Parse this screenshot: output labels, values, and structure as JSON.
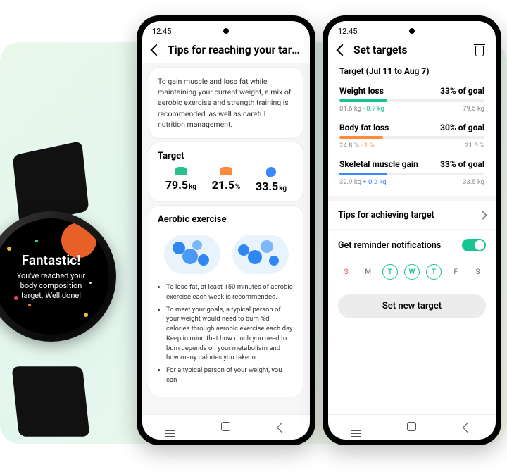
{
  "watch": {
    "title": "Fantastic!",
    "message": "You've reached your body composition target. Well done!"
  },
  "phone1": {
    "status_time": "12:45",
    "appbar_title": "Tips for reaching your targets",
    "intro": "To gain muscle and lose fat while maintaining your current weight, a mix of aerobic exercise and strength training is recommended, as well as careful nutrition management.",
    "target_heading": "Target",
    "metrics": {
      "weight": {
        "value": "79.5",
        "unit": "kg"
      },
      "bodyfat": {
        "value": "21.5",
        "unit": "%"
      },
      "muscle": {
        "value": "33.5",
        "unit": "kg"
      }
    },
    "aerobic_heading": "Aerobic exercise",
    "bullets": [
      "To lose fat, at least 150 minutes of aerobic exercise each week is recommended.",
      "To meet your goals, a typical person of your weight would need to burn %d calories through aerobic exercise each day. Keep in mind that how much you need to burn depends on your metabolism and how many calories you take in.",
      "For a typical person of your weight, you can"
    ]
  },
  "phone2": {
    "status_time": "12:45",
    "appbar_title": "Set targets",
    "period_label": "Target (Jul 11 to Aug 7)",
    "goals": [
      {
        "label": "Weight loss",
        "pct": "33% of goal",
        "fill": 33,
        "color": "green",
        "from": "81.6 kg",
        "delta": "- 0.7 kg",
        "to": "79.5 kg"
      },
      {
        "label": "Body fat loss",
        "pct": "30% of goal",
        "fill": 30,
        "color": "orange",
        "from": "24.8 %",
        "delta": "- 1 %",
        "to": "21.5 %"
      },
      {
        "label": "Skeletal muscle gain",
        "pct": "33% of goal",
        "fill": 33,
        "color": "blue",
        "from": "32.9 kg",
        "delta": "+ 0.2 kg",
        "to": "33.5 kg"
      }
    ],
    "tips_row": "Tips for achieving target",
    "reminder_row": "Get reminder notifications",
    "reminder_on": true,
    "weekdays": [
      "S",
      "M",
      "T",
      "W",
      "T",
      "F",
      "S"
    ],
    "weekdays_selected": [
      2,
      3,
      4
    ],
    "button": "Set new target"
  }
}
